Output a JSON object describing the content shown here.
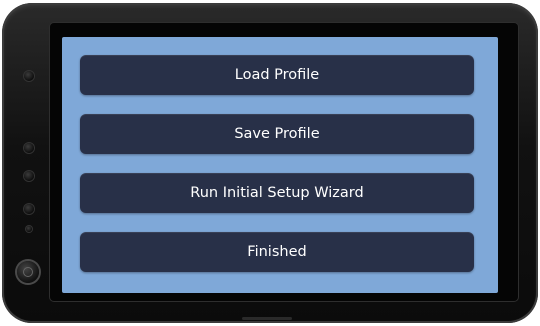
{
  "menu": {
    "items": [
      {
        "label": "Load Profile"
      },
      {
        "label": "Save Profile"
      },
      {
        "label": "Run Initial Setup Wizard"
      },
      {
        "label": "Finished"
      }
    ]
  },
  "colors": {
    "screen_background": "#7fa8d8",
    "button_background": "#283048",
    "button_text": "#ffffff",
    "device_body": "#111111"
  },
  "icons": {
    "side_buttons": [
      "side-button-icon",
      "side-button-icon",
      "side-button-icon",
      "side-button-icon"
    ],
    "power": "power-button-icon"
  }
}
